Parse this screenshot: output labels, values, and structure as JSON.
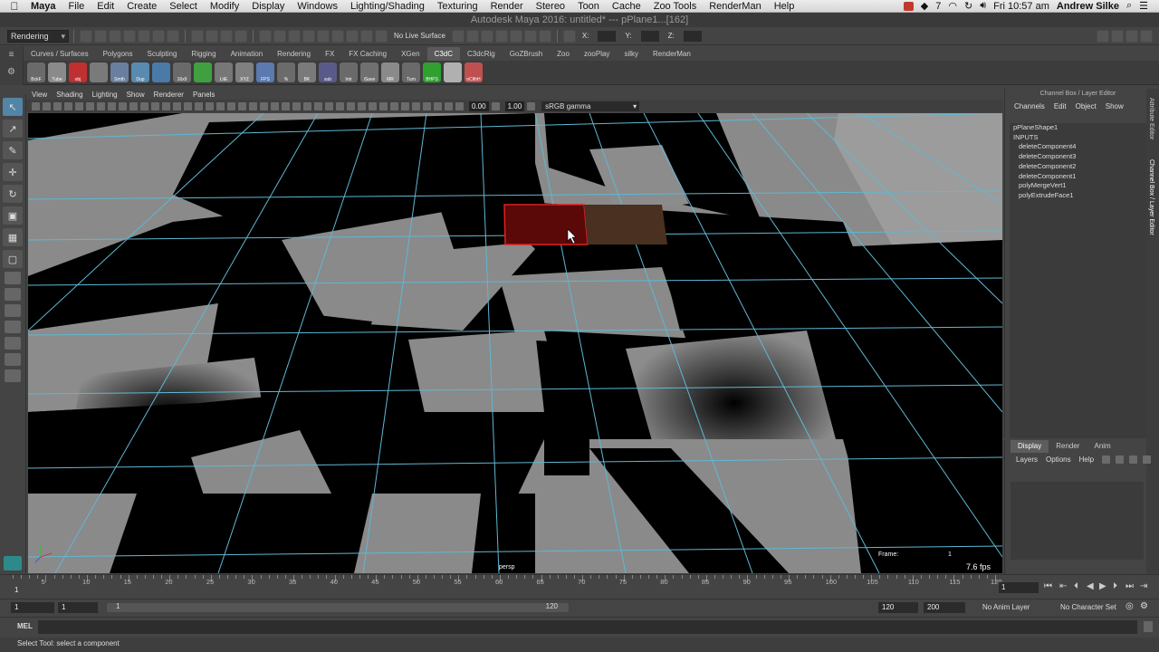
{
  "mac_menubar": {
    "app": "Maya",
    "items": [
      "File",
      "Edit",
      "Create",
      "Select",
      "Modify",
      "Display",
      "Windows",
      "Lighting/Shading",
      "Texturing",
      "Render",
      "Stereo",
      "Toon",
      "Cache",
      "Zoo Tools",
      "RenderMan",
      "Help"
    ],
    "clock": "Fri 10:57 am",
    "user": "Andrew Silke",
    "status_value": "7"
  },
  "window_title": "Autodesk Maya 2016: untitled* --- pPlane1...[162]",
  "status_line": {
    "menuset": "Rendering",
    "live_surface": "No Live Surface",
    "coord_labels": [
      "X:",
      "Y:",
      "Z:"
    ]
  },
  "shelf": {
    "tabs": [
      "Curves / Surfaces",
      "Polygons",
      "Sculpting",
      "Rigging",
      "Animation",
      "Rendering",
      "FX",
      "FX Caching",
      "XGen",
      "C3dC",
      "C3dcRig",
      "GoZBrush",
      "Zoo",
      "zooPlay",
      "silky",
      "RenderMan"
    ],
    "active_tab": "C3dC",
    "buttons": [
      {
        "label": "BckF",
        "color": "#6a6a6a"
      },
      {
        "label": "Tube",
        "color": "#8a8a8a"
      },
      {
        "label": "obj",
        "color": "#c03030"
      },
      {
        "label": "",
        "color": "#7a7a7a"
      },
      {
        "label": "Smth",
        "color": "#6a7fa0"
      },
      {
        "label": "Dup",
        "color": "#5a8ab0"
      },
      {
        "label": "",
        "color": "#4a7aa8"
      },
      {
        "label": "16x9",
        "color": "#6a6a6a"
      },
      {
        "label": "",
        "color": "#40a040"
      },
      {
        "label": "LitE",
        "color": "#777777"
      },
      {
        "label": "XYZ",
        "color": "#808080"
      },
      {
        "label": "FPS",
        "color": "#5a7ab0"
      },
      {
        "label": "%",
        "color": "#6b6b6b"
      },
      {
        "label": "BK",
        "color": "#7a7a7a"
      },
      {
        "label": "sub",
        "color": "#5a5a8a"
      },
      {
        "label": "Intr",
        "color": "#6a6a6a"
      },
      {
        "label": "iSave",
        "color": "#707070"
      },
      {
        "label": "MR",
        "color": "#8a8a8a"
      },
      {
        "label": "Turn",
        "color": "#6a6a6a"
      },
      {
        "label": "BHPS",
        "color": "#30a030"
      },
      {
        "label": "",
        "color": "#b0b0b0"
      },
      {
        "label": "nClthH",
        "color": "#c05050"
      }
    ]
  },
  "viewport": {
    "menus": [
      "View",
      "Shading",
      "Lighting",
      "Show",
      "Renderer",
      "Panels"
    ],
    "field_a": "0.00",
    "field_b": "1.00",
    "color_space": "sRGB gamma",
    "camera": "persp",
    "frame_label": "Frame:",
    "frame_value": "1",
    "fps": "7.6 fps"
  },
  "channel_box": {
    "title": "Channel Box / Layer Editor",
    "menus": [
      "Channels",
      "Edit",
      "Object",
      "Show"
    ],
    "shape": "pPlaneShape1",
    "inputs_label": "INPUTS",
    "inputs": [
      "deleteComponent4",
      "deleteComponent3",
      "deleteComponent2",
      "deleteComponent1",
      "polyMergeVert1",
      "polyExtrudeFace1"
    ]
  },
  "side_tabs": [
    "Attribute Editor",
    "Channel Box / Layer Editor"
  ],
  "layer_editor": {
    "tabs": [
      "Display",
      "Render",
      "Anim"
    ],
    "active_tab": "Display",
    "menus": [
      "Layers",
      "Options",
      "Help"
    ]
  },
  "time_slider": {
    "ticks": [
      "5",
      "10",
      "15",
      "20",
      "25",
      "30",
      "35",
      "40",
      "45",
      "50",
      "55",
      "60",
      "65",
      "70",
      "75",
      "80",
      "85",
      "90",
      "95",
      "100",
      "105",
      "110",
      "115",
      "120"
    ],
    "current_marker": "1",
    "current_frame": "1"
  },
  "range_slider": {
    "start": "1",
    "playback_start": "1",
    "range_start_label": "1",
    "range_end_label": "120",
    "playback_end": "120",
    "end": "200",
    "anim_layer": "No Anim Layer",
    "character_set": "No Character Set"
  },
  "command_line": {
    "label": "MEL"
  },
  "help_line": "Select Tool: select a component",
  "colors": {
    "panel_bg": "#444444",
    "wire": "#5fb8d4",
    "selection": "#e02020"
  }
}
